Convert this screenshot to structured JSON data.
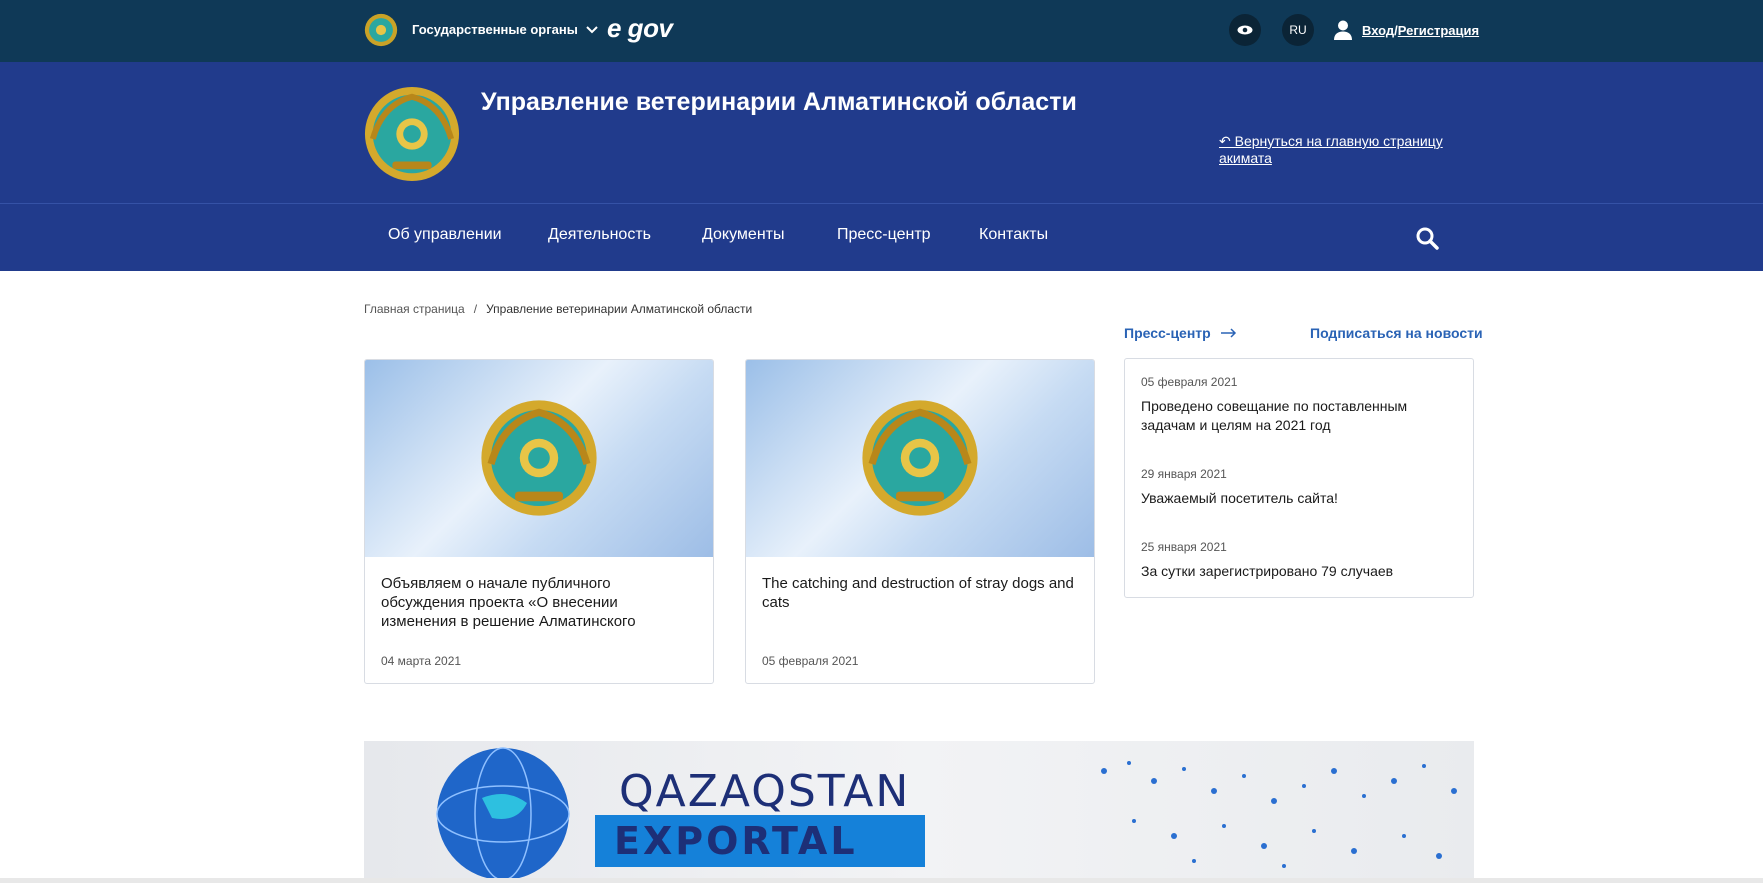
{
  "topbar": {
    "gov_menu": "Государственные органы",
    "egov": "e gov",
    "lang": "RU",
    "login": "Вход",
    "sep": "/",
    "register": "Регистрация"
  },
  "header": {
    "title": "Управление ветеринарии Алматинской области",
    "back_link": "↶ Вернуться на главную страницу акимата"
  },
  "nav": {
    "items": [
      "Об управлении",
      "Деятельность",
      "Документы",
      "Пресс-центр",
      "Контакты"
    ]
  },
  "breadcrumb": {
    "home": "Главная страница",
    "sep": "/",
    "current": "Управление ветеринарии Алматинской области"
  },
  "cards": [
    {
      "title": "Объявляем о начале публичного обсуждения проекта «О внесении изменения в решение Алматинского",
      "date": "04 марта 2021"
    },
    {
      "title": "The catching and destruction of stray dogs and cats",
      "date": "05 февраля 2021"
    }
  ],
  "sidebar": {
    "press_center": "Пресс-центр",
    "subscribe": "Подписаться на новости",
    "news": [
      {
        "date": "05 февраля 2021",
        "title": "Проведено совещание по поставленным задачам и целям на 2021 год"
      },
      {
        "date": "29 января 2021",
        "title": "Уважаемый посетитель сайта!"
      },
      {
        "date": "25 января 2021",
        "title": "За сутки зарегистрировано 79 случаев"
      }
    ]
  },
  "banner": {
    "line1": "QAZAQSTAN",
    "line2": "EXPORTAL"
  },
  "colors": {
    "topbar": "#0f3957",
    "header": "#213b8c",
    "link": "#2a63b5"
  }
}
